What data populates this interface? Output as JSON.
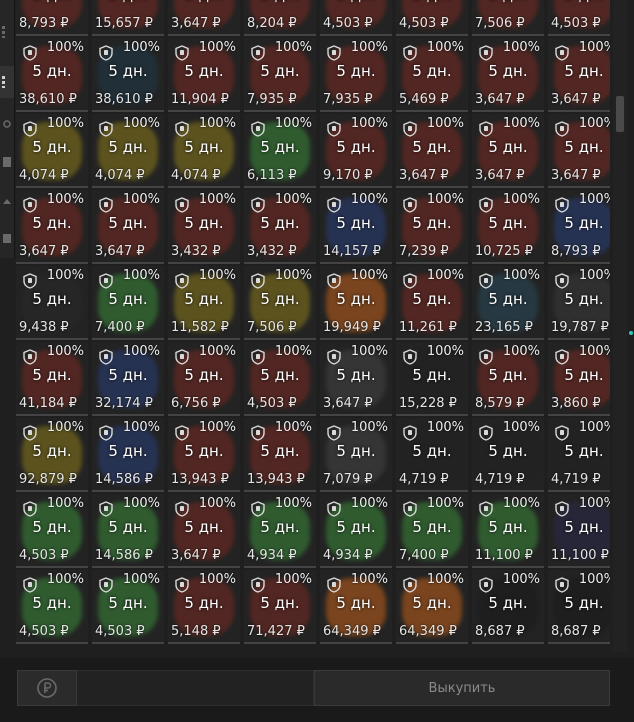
{
  "grid": {
    "duration": "5 дн.",
    "percent": "100%",
    "currency": "₽",
    "rows": [
      [
        "8,793",
        "15,657",
        "3,647",
        "8,204",
        "4,503",
        "4,503",
        "7,506",
        "4,503"
      ],
      [
        "38,610",
        "38,610",
        "11,904",
        "7,935",
        "7,935",
        "5,469",
        "3,647",
        "3,647"
      ],
      [
        "4,074",
        "4,074",
        "4,074",
        "6,113",
        "9,170",
        "3,647",
        "3,647",
        "3,647"
      ],
      [
        "3,647",
        "3,647",
        "3,432",
        "3,432",
        "14,157",
        "7,239",
        "10,725",
        "8,793"
      ],
      [
        "9,438",
        "7,400",
        "11,582",
        "7,506",
        "19,949",
        "11,261",
        "23,165",
        "19,787"
      ],
      [
        "41,184",
        "32,174",
        "6,756",
        "4,503",
        "3,647",
        "15,228",
        "8,579",
        "3,860"
      ],
      [
        "92,879",
        "14,586",
        "13,943",
        "13,943",
        "7,079",
        "4,719",
        "4,719",
        "4,719"
      ],
      [
        "4,503",
        "14,586",
        "3,647",
        "4,934",
        "4,934",
        "7,400",
        "11,100",
        "11,100"
      ],
      [
        "4,503",
        "4,503",
        "5,148",
        "71,427",
        "64,349",
        "64,349",
        "8,687",
        "8,687"
      ]
    ]
  },
  "footer": {
    "buy_label": "Выкупить"
  },
  "colors": {
    "accent_cyan": "#2fc5c5",
    "green": "#3a8a3a",
    "red": "#7a2a22",
    "blue": "#2a3f7a",
    "orange": "#c0601a",
    "gold": "#8a7a1a"
  }
}
